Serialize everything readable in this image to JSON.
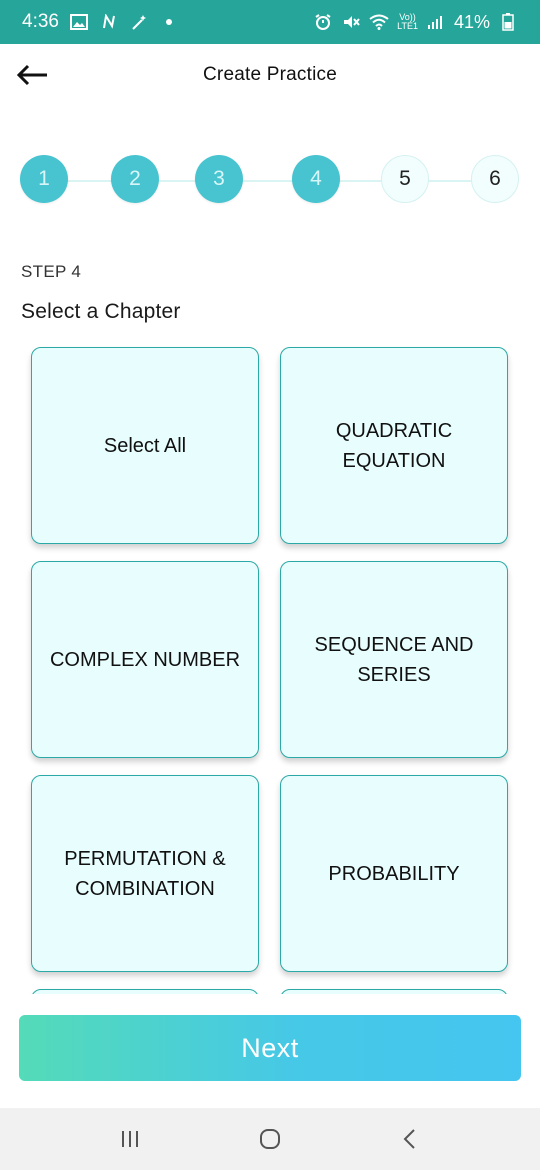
{
  "status_bar": {
    "time": "4:36",
    "battery": "41%",
    "network_top": "Vo))",
    "network_bottom": "LTE1"
  },
  "app_bar": {
    "title": "Create Practice",
    "back_icon": "arrow-left-icon"
  },
  "stepper": {
    "current_step": 4,
    "steps": [
      {
        "label": "1",
        "state": "done"
      },
      {
        "label": "2",
        "state": "done"
      },
      {
        "label": "3",
        "state": "done"
      },
      {
        "label": "4",
        "state": "done"
      },
      {
        "label": "5",
        "state": "todo"
      },
      {
        "label": "6",
        "state": "todo"
      }
    ]
  },
  "step_label": "STEP 4",
  "section_title": "Select a Chapter",
  "chapters": [
    {
      "label": "Select All"
    },
    {
      "label": "QUADRATIC EQUATION"
    },
    {
      "label": "COMPLEX NUMBER"
    },
    {
      "label": "SEQUENCE AND SERIES"
    },
    {
      "label": "PERMUTATION & COMBINATION"
    },
    {
      "label": "PROBABILITY"
    },
    {
      "label": ""
    },
    {
      "label": ""
    }
  ],
  "next_button": {
    "label": "Next"
  },
  "colors": {
    "status_bar": "#26a69a",
    "step_done": "#47c4cf",
    "card_bg": "#e8fdfd",
    "card_border": "#2aa9a6",
    "button_gradient_start": "#54dbb8",
    "button_gradient_end": "#44c6f0"
  },
  "nav_bar": {
    "icons": [
      "recent-apps-icon",
      "home-icon",
      "back-nav-icon"
    ]
  }
}
